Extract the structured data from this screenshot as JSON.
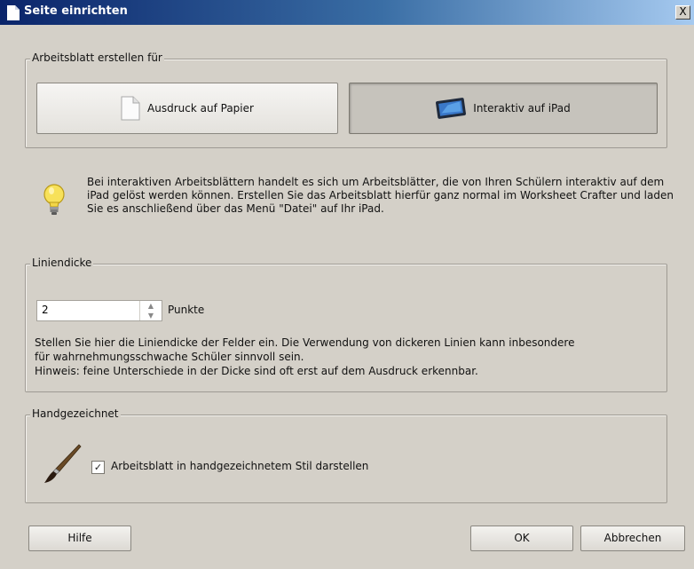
{
  "window": {
    "title": "Seite einrichten",
    "close_label": "X"
  },
  "mode_group": {
    "label": "Arbeitsblatt erstellen für",
    "options": [
      {
        "label": "Ausdruck auf Papier",
        "icon": "document-icon",
        "selected": false
      },
      {
        "label": "Interaktiv auf iPad",
        "icon": "tablet-icon",
        "selected": true
      }
    ]
  },
  "info": {
    "icon": "lightbulb-icon",
    "text": "Bei interaktiven Arbeitsblättern handelt es sich um Arbeitsblätter, die von Ihren Schülern interaktiv auf dem iPad gelöst werden können. Erstellen Sie das Arbeitsblatt hierfür ganz normal im Worksheet Crafter und laden Sie es anschließend über das Menü \"Datei\" auf Ihr iPad."
  },
  "line_group": {
    "label": "Liniendicke",
    "value": "2",
    "unit": "Punkte",
    "help_line1": "Stellen Sie hier die Liniendicke der Felder ein. Die Verwendung von dickeren Linien kann inbesondere",
    "help_line2": "für wahrnehmungsschwache Schüler sinnvoll sein.",
    "help_line3": "Hinweis: feine Unterschiede in der Dicke sind oft erst auf dem Ausdruck erkennbar."
  },
  "hand_group": {
    "label": "Handgezeichnet",
    "icon": "brush-icon",
    "checkbox_label": "Arbeitsblatt in handgezeichnetem Stil darstellen",
    "checked": true
  },
  "buttons": {
    "help": "Hilfe",
    "ok": "OK",
    "cancel": "Abbrechen"
  }
}
